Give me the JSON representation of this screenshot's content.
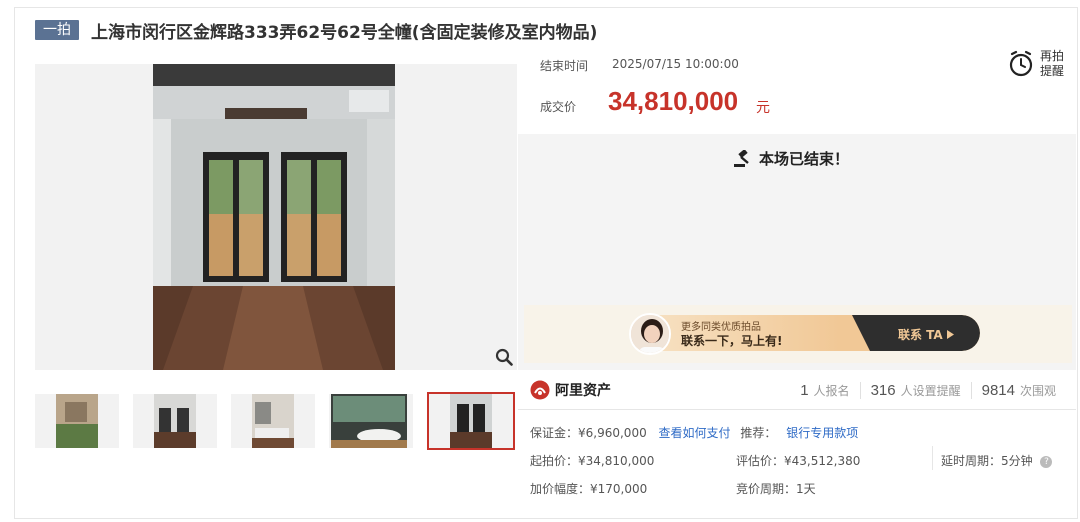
{
  "header": {
    "tag": "一拍",
    "title": "上海市闵行区金辉路333弄62号62号全幢(含固定装修及室内物品)"
  },
  "auction": {
    "end_label": "结束时间",
    "end_time": "2025/07/15 10:00:00",
    "price_label": "成交价",
    "price": "34,810,000",
    "price_unit": "元",
    "remind_label": "再拍提醒",
    "status": "本场已结束！"
  },
  "banner": {
    "small_text": "更多同类优质拍品",
    "big_text": "联系一下，马上有!",
    "cta": "联系 TA"
  },
  "stats": {
    "brand": "阿里资产",
    "items": [
      {
        "num": "1",
        "label": "人报名"
      },
      {
        "num": "316",
        "label": "人设置提醒"
      },
      {
        "num": "9814",
        "label": "次围观"
      }
    ]
  },
  "details": {
    "deposit": "保证金：¥6,960,000",
    "how_to_pay": "查看如何支付",
    "recommend_label": "推荐：",
    "bank_link": "银行专用款项",
    "start_price": "起拍价：¥34,810,000",
    "eval_price": "评估价：¥43,512,380",
    "delay": "延时周期：5分钟",
    "increment": "加价幅度：¥170,000",
    "bid_cycle": "竞价周期：1天"
  },
  "colors": {
    "accent_red": "#c7332a",
    "tag_blue": "#5b7293",
    "link_blue": "#2f6bc6"
  }
}
